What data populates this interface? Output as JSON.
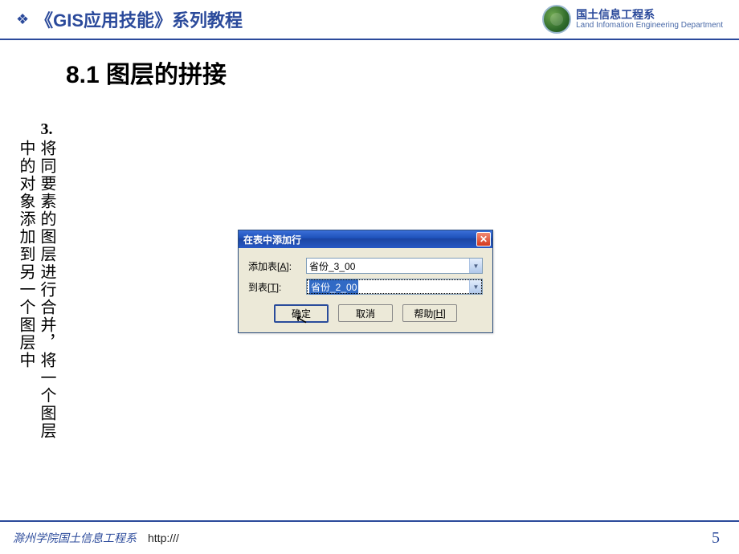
{
  "header": {
    "series_title": "《GIS应用技能》系列教程",
    "dept_cn": "国土信息工程系",
    "dept_en": "Land Infomation Engineering Department"
  },
  "slide": {
    "title": "8.1  图层的拼接",
    "bullet_number": "3.",
    "body_line1": "将同要素的图层进行合并，将一个图层",
    "body_line2": "中的对象添加到另一个图层中"
  },
  "dialog": {
    "title": "在表中添加行",
    "close_symbol": "✕",
    "label_add": "添加表[",
    "label_add_u": "A",
    "label_add_after": "]:",
    "value_add": "省份_3_00",
    "label_to": "到表[",
    "label_to_u": "T",
    "label_to_after": "]:",
    "value_to": "省份_2_00",
    "btn_ok": "确定",
    "btn_cancel": "取消",
    "btn_help_pre": "帮助[",
    "btn_help_u": "H",
    "btn_help_post": "]"
  },
  "footer": {
    "org": "滁州学院国土信息工程系",
    "link": "http:///",
    "page": "5"
  }
}
